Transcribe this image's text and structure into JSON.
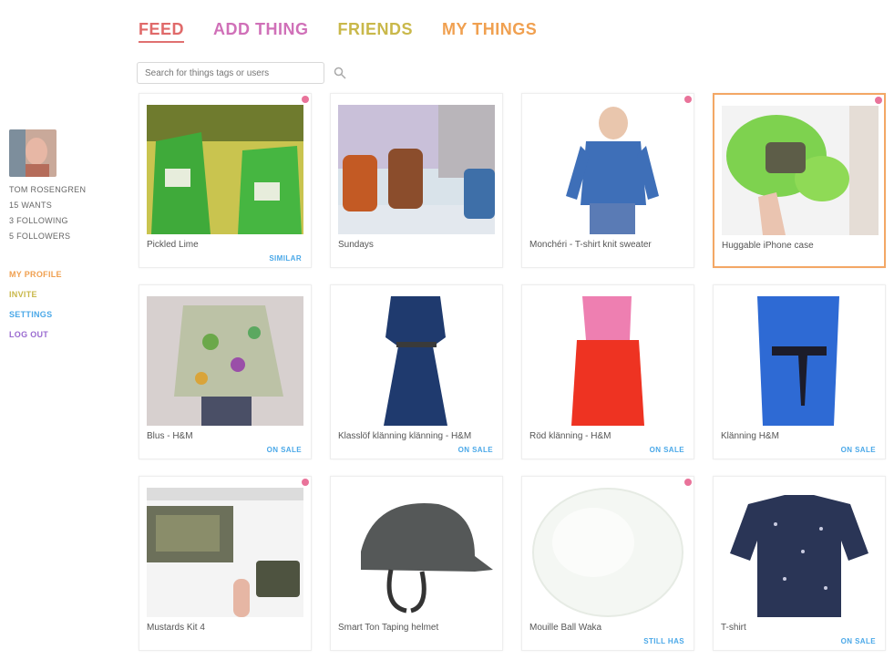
{
  "nav": {
    "feed": "FEED",
    "add": "ADD THING",
    "friends": "FRIENDS",
    "mine": "MY THINGS",
    "colors": {
      "feed": "#e06a6a",
      "add": "#d070b8",
      "friends": "#c9b84a",
      "mine": "#f0a050"
    }
  },
  "search": {
    "placeholder": "Search for things tags or users"
  },
  "sidebar": {
    "stats": [
      "TOM ROSENGREN",
      "15 WANTS",
      "3 FOLLOWING",
      "5 FOLLOWERS"
    ],
    "links": [
      {
        "label": "MY PROFILE",
        "color": "#f0a050"
      },
      {
        "label": "INVITE",
        "color": "#c9b84a"
      },
      {
        "label": "SETTINGS",
        "color": "#4aa8e8"
      },
      {
        "label": "LOG OUT",
        "color": "#9a6ad0"
      }
    ]
  },
  "cards": [
    {
      "title": "Pickled Lime",
      "cta": "SIMILAR"
    },
    {
      "title": "Sundays",
      "cta": ""
    },
    {
      "title": "Monchéri - T-shirt knit sweater",
      "cta": ""
    },
    {
      "title": "Huggable iPhone case",
      "cta": ""
    },
    {
      "title": "Blus - H&M",
      "cta": "ON SALE"
    },
    {
      "title": "Klasslöf klänning klänning - H&M",
      "cta": "ON SALE"
    },
    {
      "title": "Röd klänning - H&M",
      "cta": "ON SALE"
    },
    {
      "title": "Klänning H&M",
      "cta": "ON SALE"
    },
    {
      "title": "Mustards Kit 4",
      "cta": ""
    },
    {
      "title": "Smart Ton Taping helmet",
      "cta": ""
    },
    {
      "title": "Mouille Ball Waka",
      "cta": "STILL HAS"
    },
    {
      "title": "T-shirt",
      "cta": "ON SALE"
    }
  ]
}
